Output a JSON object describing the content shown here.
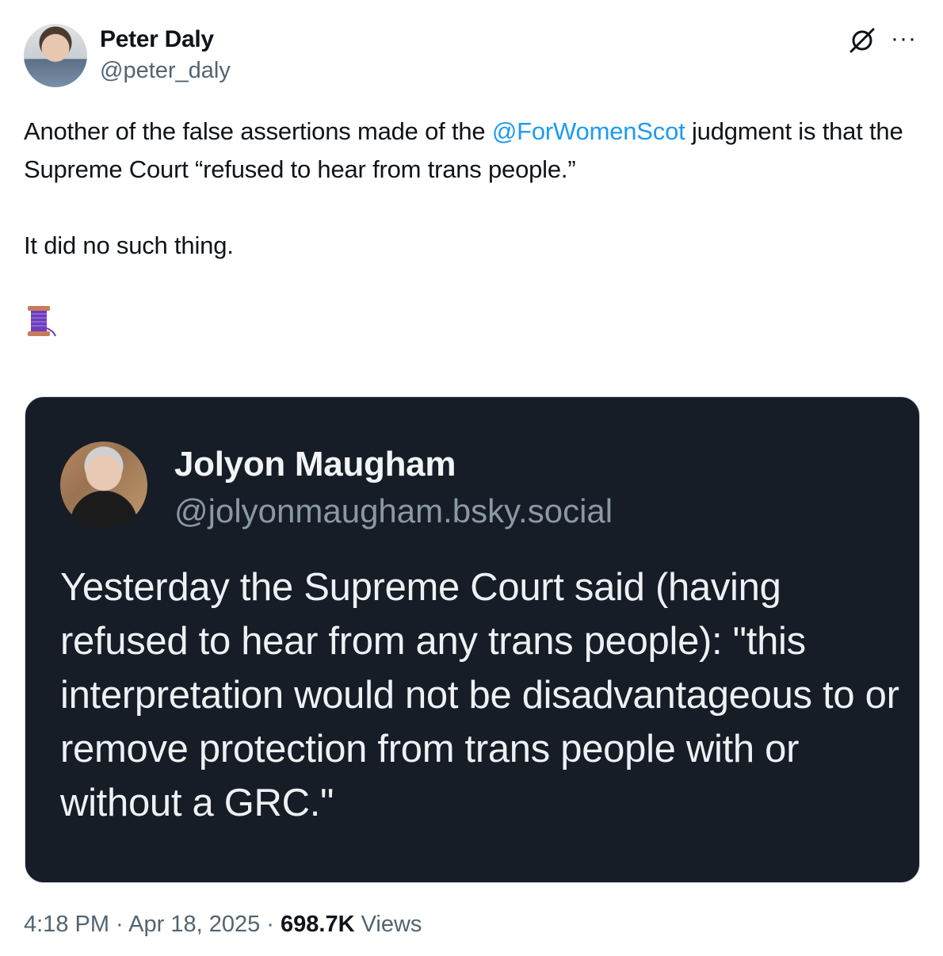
{
  "author": {
    "name": "Peter Daly",
    "handle": "@peter_daly"
  },
  "header_icons": {
    "grok": "grok-icon",
    "more": "more-options-icon",
    "more_glyph": "···"
  },
  "tweet": {
    "line1_before": "Another of the false assertions made of the ",
    "mention": "@ForWomenScot",
    "line1_after": " judgment is that the Supreme Court “refused to hear from trans people.”",
    "line2": "It did no such thing.",
    "thread_emoji": "spool-of-thread-icon"
  },
  "quoted": {
    "name": "Jolyon Maugham",
    "handle": "@jolyonmaugham.bsky.social",
    "text": "Yesterday the Supreme Court said (having refused to hear from any trans people): \"this interpretation would not be disadvantageous to or remove protection from trans people with or without a GRC.\""
  },
  "meta": {
    "time": "4:18 PM",
    "sep1": " · ",
    "date": "Apr 18, 2025",
    "sep2": " · ",
    "views_count": "698.7K",
    "views_label": " Views"
  }
}
